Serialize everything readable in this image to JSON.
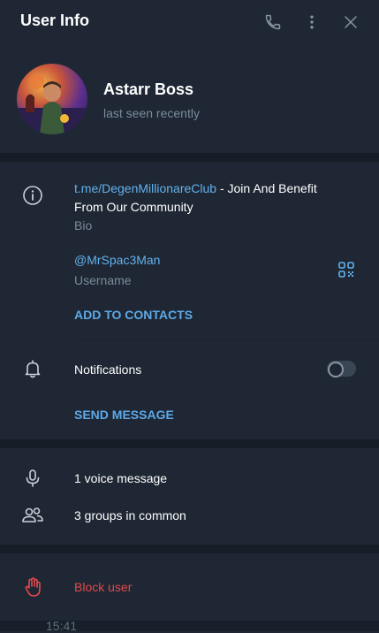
{
  "header": {
    "title": "User Info"
  },
  "profile": {
    "name": "Astarr Boss",
    "status": "last seen recently"
  },
  "bio": {
    "link": "t.me/DegenMillionareClub",
    "text_rest": " - Join And Benefit",
    "text_line2": "From Our Community",
    "label": "Bio"
  },
  "username": {
    "value": "@MrSpac3Man",
    "label": "Username"
  },
  "actions": {
    "add_contact": "ADD TO CONTACTS",
    "send_message": "SEND MESSAGE"
  },
  "notifications": {
    "label": "Notifications",
    "enabled": false
  },
  "media": {
    "voice": "1 voice message",
    "groups": "3 groups in common"
  },
  "block": {
    "label": "Block user"
  },
  "background": {
    "timestamp": "15:41"
  },
  "colors": {
    "accent": "#64b1ee",
    "danger": "#e5484d",
    "panel": "#1e2733"
  }
}
